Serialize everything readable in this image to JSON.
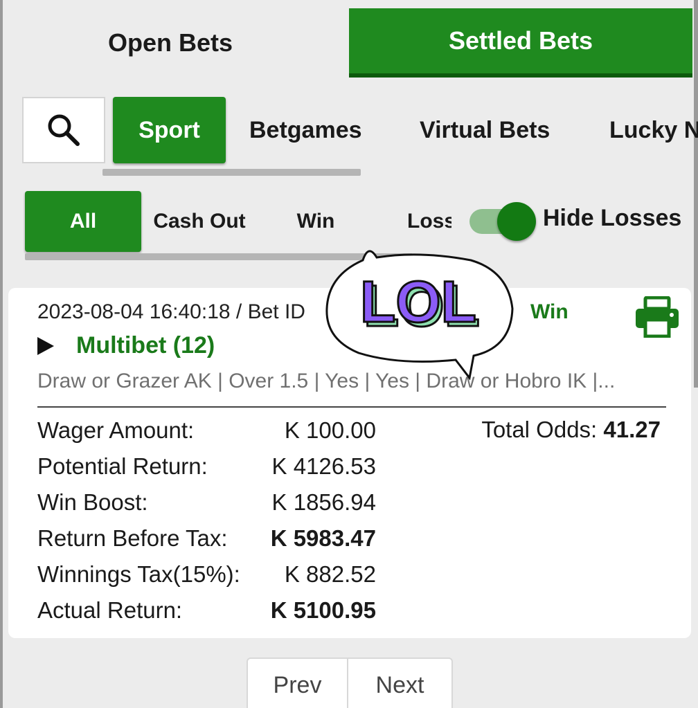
{
  "tabs": {
    "open_bets": "Open Bets",
    "settled_bets": "Settled Bets"
  },
  "categories": [
    "Sport",
    "Betgames",
    "Virtual Bets",
    "Lucky N"
  ],
  "filters": {
    "all": "All",
    "cash_out": "Cash Out",
    "win": "Win",
    "loss": "Loss"
  },
  "toggle": {
    "label": "Hide Losses",
    "on": true
  },
  "bet": {
    "header": "2023-08-04 16:40:18 / Bet ID",
    "status": "Win",
    "type": "Multibet (12)",
    "selections": "Draw or Grazer AK | Over 1.5 | Yes | Yes | Draw or Hobro IK |...",
    "rows": [
      {
        "label": "Wager Amount:",
        "value": "K 100.00"
      },
      {
        "label": "Potential Return:",
        "value": "K 4126.53"
      },
      {
        "label": "Win Boost:",
        "value": "K 1856.94"
      },
      {
        "label": "Return Before Tax:",
        "value": "K 5983.47"
      },
      {
        "label": "Winnings Tax(15%):",
        "value": "K 882.52"
      },
      {
        "label": "Actual Return:",
        "value": "K 5100.95"
      }
    ],
    "total_odds_label": "Total Odds:",
    "total_odds_value": "41.27"
  },
  "pagination": {
    "prev": "Prev",
    "next": "Next"
  },
  "sticker": {
    "text": "LOL"
  },
  "colors": {
    "accent": "#1f8a1f",
    "accent_dark": "#0c5a0c",
    "win_text": "#1a7a1a",
    "sticker_fill": "#8b5cf6"
  },
  "icons": {
    "search": "search-icon",
    "print": "printer-icon",
    "expand": "play-icon"
  }
}
